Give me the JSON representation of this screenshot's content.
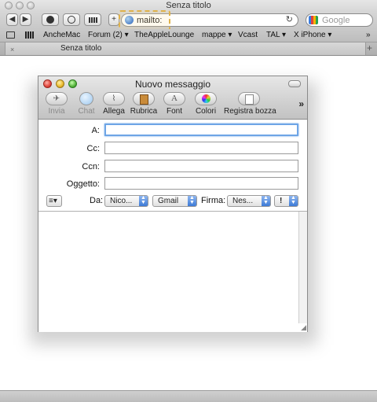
{
  "browser": {
    "window_title": "Senza titolo",
    "toolbar": {
      "back_icon": "◀",
      "forward_icon": "▶",
      "add_icon": "+",
      "address": "mailto:",
      "reload_icon": "↻",
      "search_placeholder": "Google"
    },
    "bookmarks": [
      {
        "label": "AncheMac"
      },
      {
        "label": "Forum (2) ▾"
      },
      {
        "label": "TheAppleLounge"
      },
      {
        "label": "mappe ▾"
      },
      {
        "label": "Vcast"
      },
      {
        "label": "TAL ▾"
      },
      {
        "label": "X iPhone ▾"
      }
    ],
    "bookmarks_overflow": "»",
    "tab": {
      "title": "Senza titolo",
      "close": "×",
      "add": "+"
    }
  },
  "mail": {
    "title": "Nuovo messaggio",
    "toolbar": [
      {
        "label": "Invia",
        "icon": "send-icon",
        "enabled": false
      },
      {
        "label": "Chat",
        "icon": "chat-icon",
        "enabled": false
      },
      {
        "label": "Allega",
        "icon": "paperclip-icon",
        "enabled": true
      },
      {
        "label": "Rubrica",
        "icon": "address-book-icon",
        "enabled": true
      },
      {
        "label": "Font",
        "icon": "font-icon",
        "enabled": true
      },
      {
        "label": "Colori",
        "icon": "colors-icon",
        "enabled": true
      },
      {
        "label": "Registra bozza",
        "icon": "save-draft-icon",
        "enabled": true
      }
    ],
    "toolbar_overflow": "»",
    "fields": [
      {
        "label": "A:",
        "value": ""
      },
      {
        "label": "Cc:",
        "value": ""
      },
      {
        "label": "Ccn:",
        "value": ""
      },
      {
        "label": "Oggetto:",
        "value": ""
      }
    ],
    "options_row": {
      "menu_icon": "≡▾",
      "from_label": "Da:",
      "from_value": "Nico...",
      "account_value": "Gmail",
      "signature_label": "Firma:",
      "signature_value": "Nes...",
      "priority_value": "!"
    }
  }
}
